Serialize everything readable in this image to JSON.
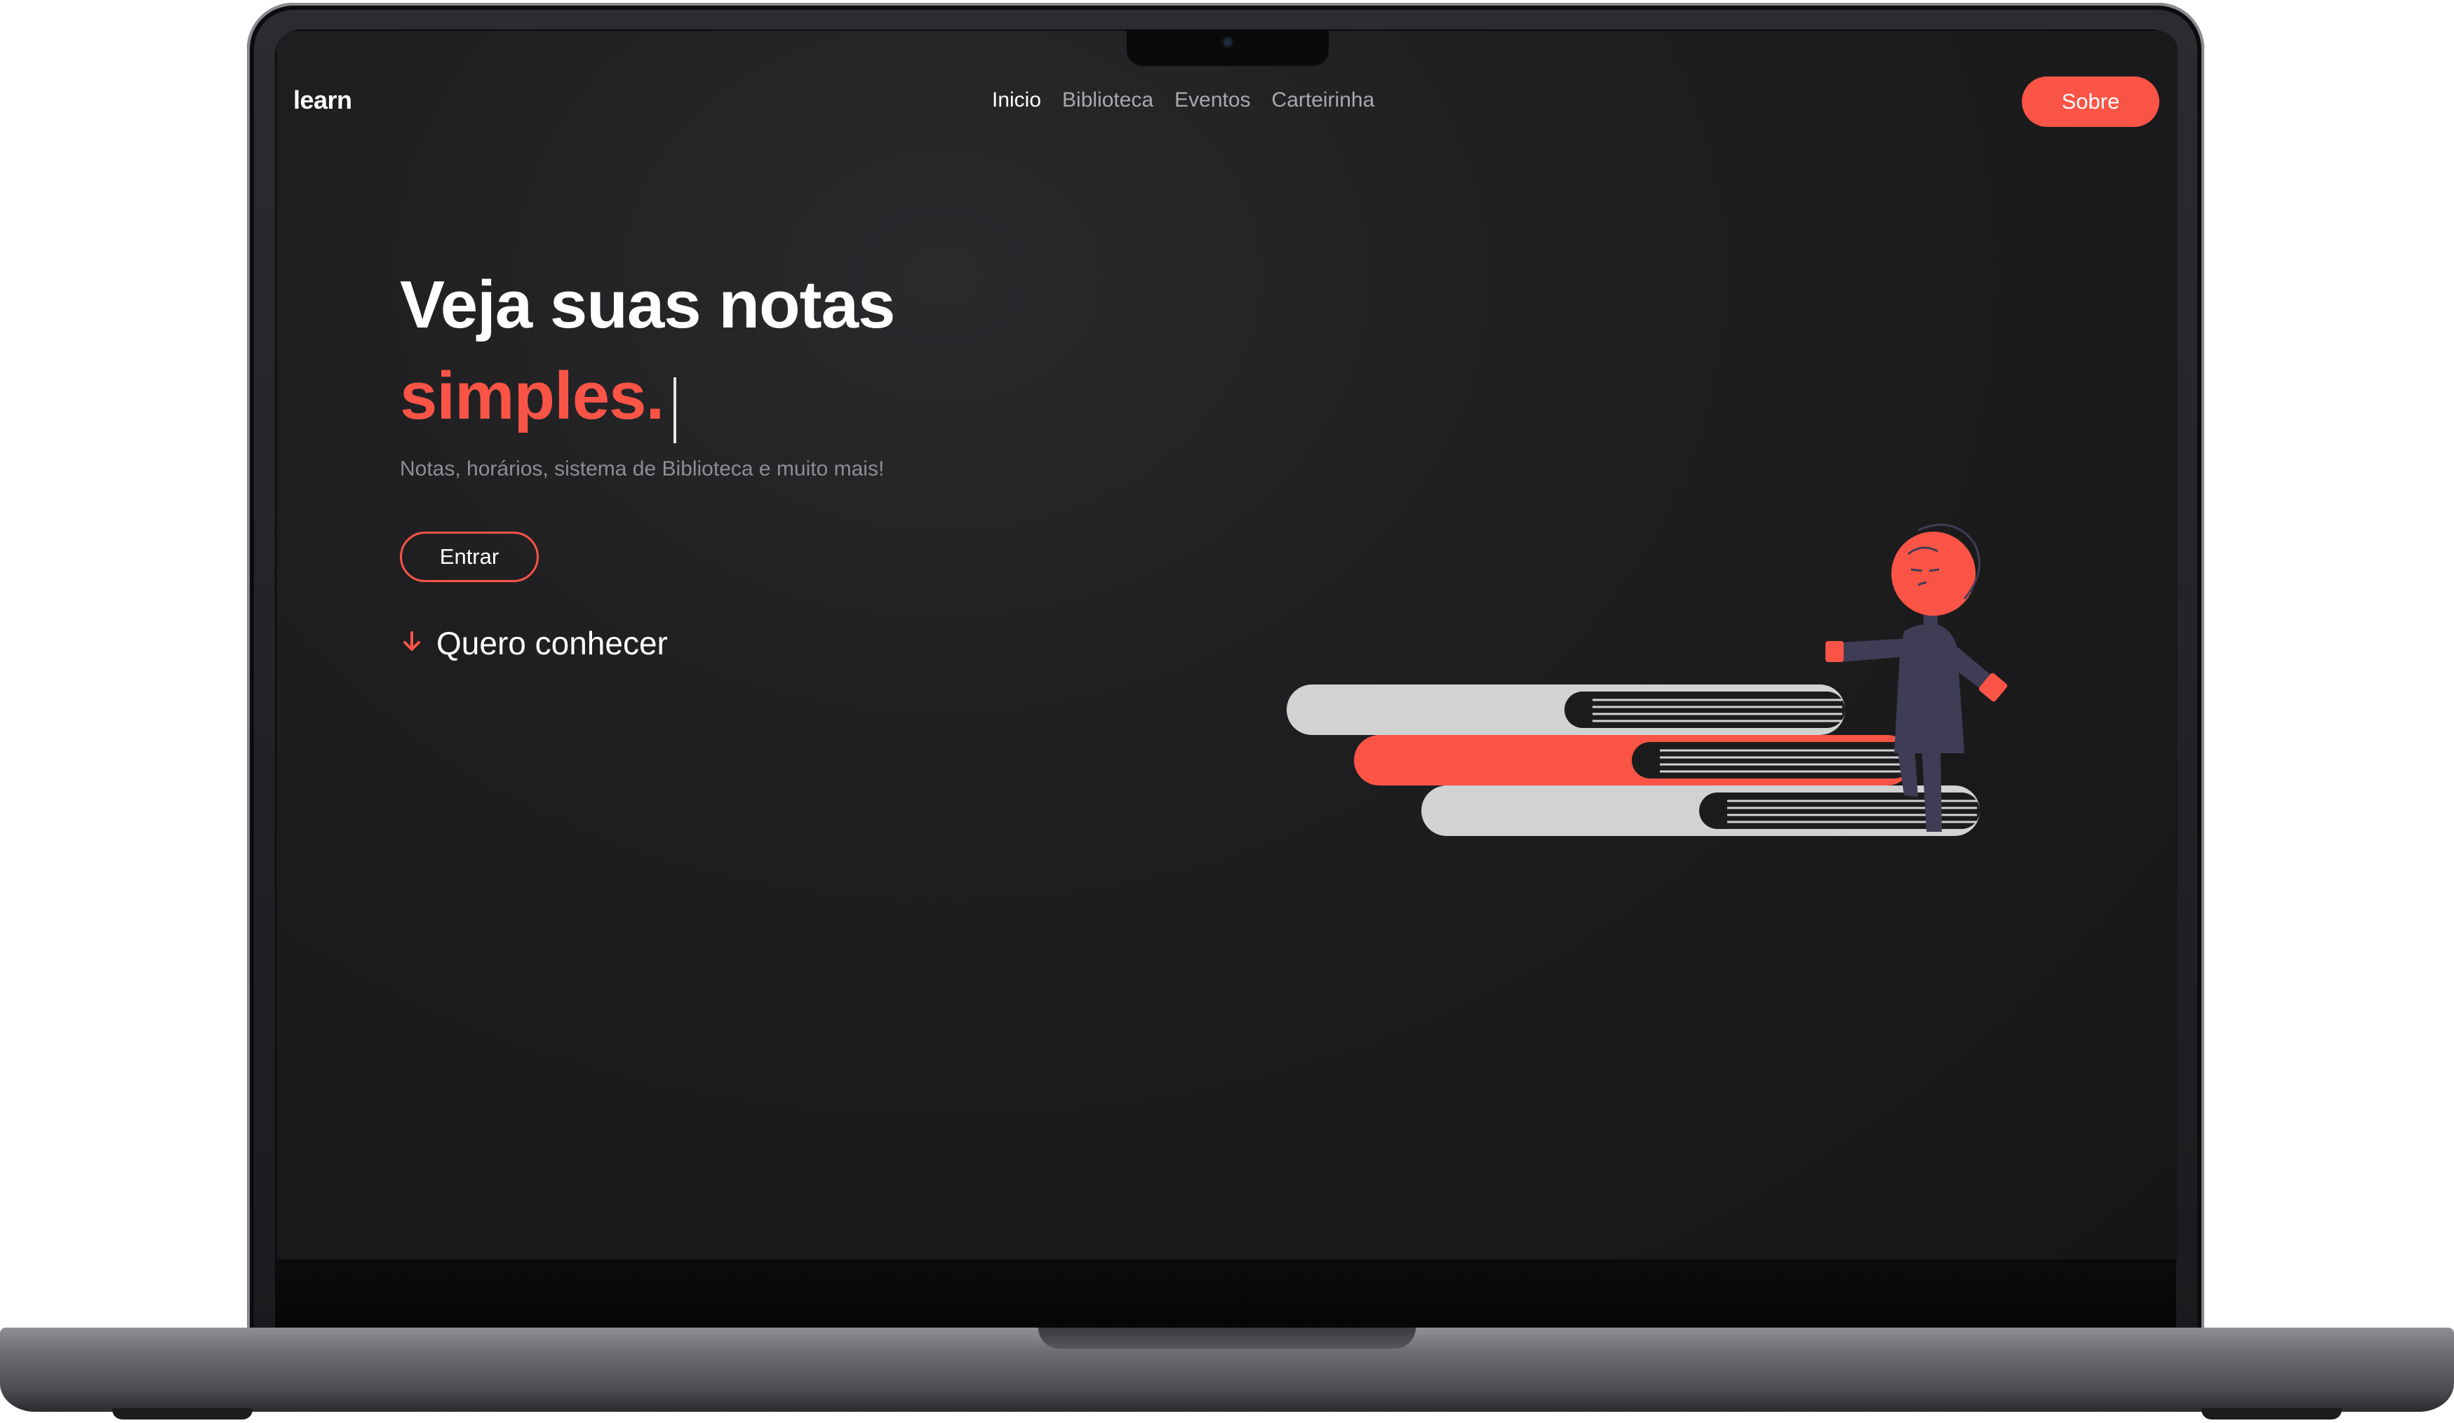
{
  "brand": {
    "logo": "learn"
  },
  "nav": {
    "items": [
      {
        "label": "Inicio",
        "active": true
      },
      {
        "label": "Biblioteca",
        "active": false
      },
      {
        "label": "Eventos",
        "active": false
      },
      {
        "label": "Carteirinha",
        "active": false
      }
    ],
    "cta_label": "Sobre"
  },
  "hero": {
    "title": "Veja suas notas",
    "accent": "simples.",
    "subtitle": "Notas, horários, sistema de Biblioteca e muito mais!",
    "primary_button": "Entrar",
    "scroll_link": "Quero conhecer",
    "scroll_icon": "arrow-down-icon"
  },
  "colors": {
    "accent": "#fa5446",
    "background": "#1e1e20",
    "text_primary": "#ffffff",
    "text_muted": "#8d8d93",
    "book_light": "#d2d2d2",
    "figure_body": "#3f3d56"
  }
}
